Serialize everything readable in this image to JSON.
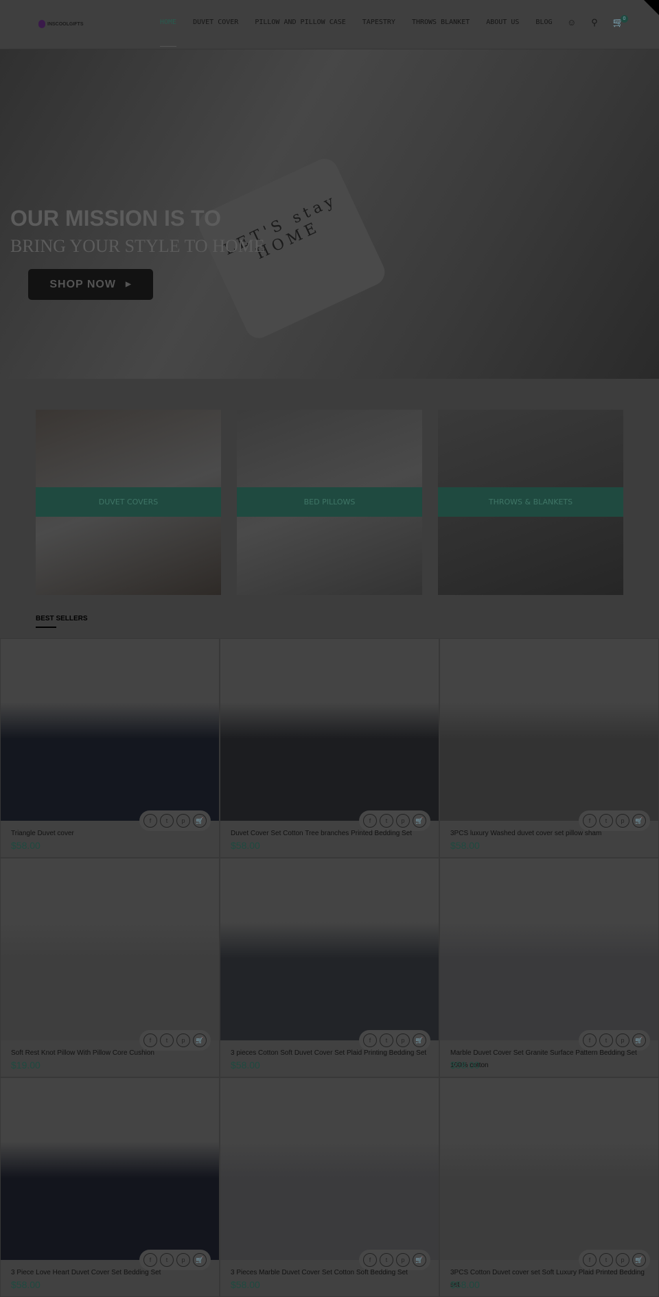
{
  "header": {
    "logo": "INSCOOLGIFTS",
    "nav": [
      "HOME",
      "DUVET COVER",
      "PILLOW AND PILLOW CASE",
      "TAPESTRY",
      "THROWS BLANKET",
      "ABOUT US",
      "BLOG"
    ],
    "cart_count": "0",
    "icons": [
      "user-icon",
      "search-icon",
      "cart-icon"
    ]
  },
  "hero": {
    "line1": "OUR MISSION IS TO",
    "line2": "BRING YOUR STYLE TO HOME",
    "pillow_text": "LET'S stay HOME",
    "button": "SHOP NOW"
  },
  "categories": [
    "DUVET COVERS",
    "BED PILLOWS",
    "THROWS & BLANKETS"
  ],
  "best_sellers": {
    "heading": "BEST SELLERS",
    "products": [
      {
        "title": "Triangle Duvet cover",
        "price": "$58.00"
      },
      {
        "title": "Duvet Cover Set Cotton Tree branches Printed Bedding Set",
        "price": "$58.00"
      },
      {
        "title": "3PCS luxury Washed duvet cover set pillow sham",
        "price": "$58.00"
      },
      {
        "title": "Soft Rest Knot Pillow With Pillow Core Cushion",
        "price": "$19.00"
      },
      {
        "title": "3 pieces Cotton Soft Duvet Cover Set Plaid Printing Bedding Set",
        "price": "$58.00"
      },
      {
        "title": "Marble Duvet Cover Set Granite Surface Pattern Bedding Set 100% cotton",
        "price": "$58.00"
      },
      {
        "title": "3 Piece Love Heart Duvet Cover Set Bedding Set",
        "price": "$58.00"
      },
      {
        "title": "3 Pieces Marble Duvet Cover Set Cotton Soft Bedding Set",
        "price": "$58.00"
      },
      {
        "title": "3PCS Cotton Duvet cover set Soft Luxury Plaid Printed Bedding set",
        "price": "$58.00"
      }
    ]
  },
  "colors": {
    "accent": "#1abc9c",
    "overlay": "rgba(0,0,0,0.74)"
  }
}
